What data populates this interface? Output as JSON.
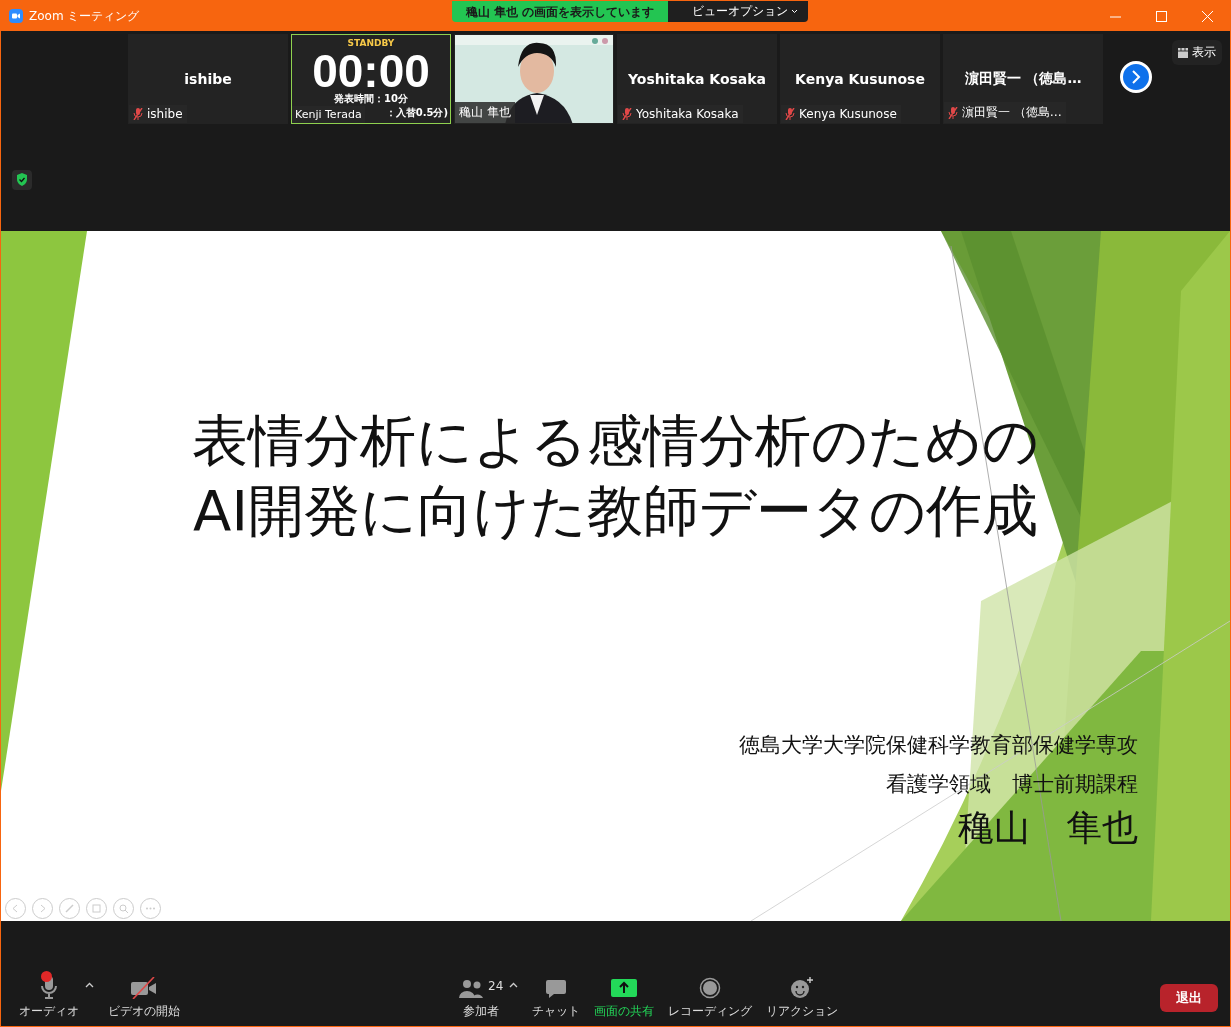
{
  "window": {
    "title": "Zoom ミーティング"
  },
  "share_banner": {
    "text": "穐山 隼也 の画面を表示しています",
    "view_options": "ビューオプション"
  },
  "tiles": [
    {
      "kind": "name",
      "display_name": "ishibe",
      "label": "ishibe",
      "muted": true,
      "selected": false
    },
    {
      "kind": "timer",
      "status": "STANDBY",
      "time": "00:00",
      "lines": [
        "発表時間：10分",
        "：入替0.5分)"
      ],
      "label": "Kenji Terada",
      "muted": false,
      "selected": true
    },
    {
      "kind": "video",
      "label": "穐山 隼也",
      "muted": false,
      "selected": false
    },
    {
      "kind": "name",
      "display_name": "Yoshitaka Kosaka",
      "label": "Yoshitaka Kosaka",
      "muted": true,
      "selected": false
    },
    {
      "kind": "name",
      "display_name": "Kenya Kusunose",
      "label": "Kenya Kusunose",
      "muted": true,
      "selected": false
    },
    {
      "kind": "name",
      "display_name": "濵田賢一 （徳島…",
      "label": "濵田賢一 （徳島…",
      "muted": true,
      "selected": false
    }
  ],
  "view_button": "表示",
  "slide": {
    "title_lines": [
      "表情分析による感情分析のための",
      "AI開発に向けた教師データの作成"
    ],
    "affiliation_lines": [
      "徳島大学大学院保健科学教育部保健学専攻",
      "看護学領域　博士前期課程"
    ],
    "presenter": "穐山　隼也"
  },
  "toolbar": {
    "items": [
      {
        "kind": "audio",
        "label": "オーディオ",
        "alert": true,
        "caret": true
      },
      {
        "kind": "video",
        "label": "ビデオの開始",
        "caret": false
      },
      {
        "kind": "participants",
        "label": "参加者",
        "count": "24",
        "caret": true
      },
      {
        "kind": "chat",
        "label": "チャット",
        "caret": false
      },
      {
        "kind": "share",
        "label": "画面の共有",
        "active": true,
        "caret": false
      },
      {
        "kind": "record",
        "label": "レコーディング",
        "caret": false
      },
      {
        "kind": "reaction",
        "label": "リアクション",
        "caret": false
      }
    ],
    "leave": "退出"
  }
}
